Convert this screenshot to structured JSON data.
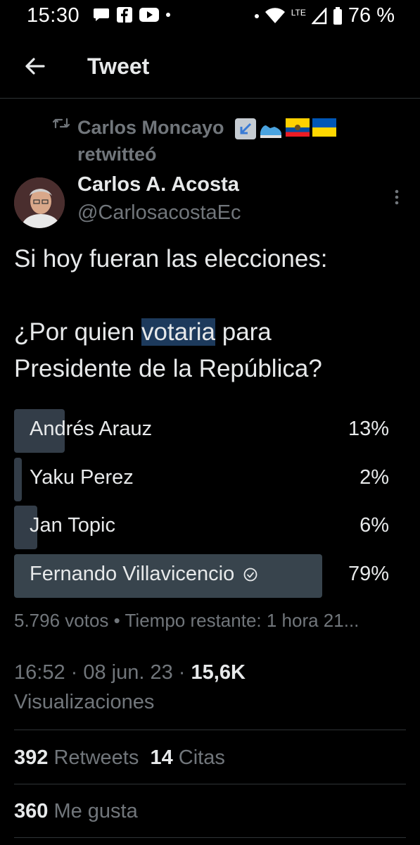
{
  "status_bar": {
    "time": "15:30",
    "network": "LTE",
    "battery": "76 %"
  },
  "header": {
    "title": "Tweet"
  },
  "retweet": {
    "user": "Carlos Moncayo",
    "action": "retwitteó"
  },
  "author": {
    "name": "Carlos A. Acosta",
    "handle": "@CarlosacostaEc"
  },
  "tweet": {
    "line1": "Si hoy fueran las elecciones:",
    "q_pre": "¿Por quien ",
    "q_hl": "votaria",
    "q_post": " para",
    "line3": "Presidente de la República?"
  },
  "poll": {
    "options": [
      {
        "label": "Andrés Arauz",
        "percent_text": "13%",
        "percent": 13,
        "winner": false
      },
      {
        "label": "Yaku Perez",
        "percent_text": "2%",
        "percent": 2,
        "winner": false
      },
      {
        "label": "Jan Topic",
        "percent_text": "6%",
        "percent": 6,
        "winner": false
      },
      {
        "label": "Fernando Villavicencio",
        "percent_text": "79%",
        "percent": 79,
        "winner": true
      }
    ],
    "meta": "5.796 votos • Tiempo restante: 1 hora 21..."
  },
  "timestamp": {
    "time_date": "16:52 · 08 jun. 23 · ",
    "views_count": "15,6K",
    "views_label": "Visualizaciones"
  },
  "stats": {
    "retweets_count": "392",
    "retweets_label": "Retweets",
    "quotes_count": "14",
    "quotes_label": "Citas",
    "likes_count": "360",
    "likes_label": "Me gusta"
  },
  "colors": {
    "background": "#000000",
    "text": "#e7e9ea",
    "muted": "#71767b",
    "poll_bar": "#333d48",
    "highlight": "#1d3a5c"
  }
}
